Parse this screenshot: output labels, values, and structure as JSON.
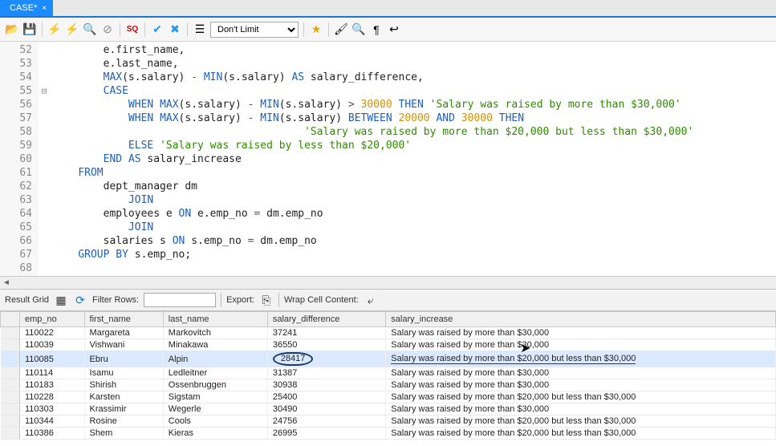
{
  "tab": {
    "title": "CASE*",
    "close": "×"
  },
  "toolbar": {
    "limit_value": "Don't Limit"
  },
  "editor": {
    "lines": [
      {
        "n": "52",
        "html": "        e.first_name,"
      },
      {
        "n": "53",
        "html": "        e.last_name,"
      },
      {
        "n": "54",
        "html": "        <span class='fn'>MAX</span>(s.salary) <span class='op'>-</span> <span class='fn'>MIN</span>(s.salary) <span class='kw'>AS</span> salary_difference,"
      },
      {
        "n": "55",
        "html": "        <span class='kw'>CASE</span>",
        "fold": "⊟"
      },
      {
        "n": "56",
        "html": "            <span class='kw'>WHEN</span> <span class='fn'>MAX</span>(s.salary) <span class='op'>-</span> <span class='fn'>MIN</span>(s.salary) <span class='op'>&gt;</span> <span class='num'>30000</span> <span class='kw'>THEN</span> <span class='str'>'Salary was raised by more than $30,000'</span>"
      },
      {
        "n": "57",
        "html": "            <span class='kw'>WHEN</span> <span class='fn'>MAX</span>(s.salary) <span class='op'>-</span> <span class='fn'>MIN</span>(s.salary) <span class='kw'>BETWEEN</span> <span class='num'>20000</span> <span class='kw'>AND</span> <span class='num'>30000</span> <span class='kw'>THEN</span>"
      },
      {
        "n": "58",
        "html": "                                        <span class='str'>'Salary was raised by more than $20,000 but less than $30,000'</span>"
      },
      {
        "n": "59",
        "html": "            <span class='kw'>ELSE</span> <span class='str'>'Salary was raised by less than $20,000'</span>"
      },
      {
        "n": "60",
        "html": "        <span class='kw'>END</span> <span class='kw'>AS</span> salary_increase"
      },
      {
        "n": "61",
        "html": "    <span class='kw'>FROM</span>"
      },
      {
        "n": "62",
        "html": "        dept_manager dm"
      },
      {
        "n": "63",
        "html": "            <span class='kw'>JOIN</span>"
      },
      {
        "n": "64",
        "html": "        employees e <span class='kw'>ON</span> e.emp_no <span class='op'>=</span> dm.emp_no"
      },
      {
        "n": "65",
        "html": "            <span class='kw'>JOIN</span>"
      },
      {
        "n": "66",
        "html": "        salaries s <span class='kw'>ON</span> s.emp_no <span class='op'>=</span> dm.emp_no"
      },
      {
        "n": "67",
        "html": "    <span class='kw'>GROUP BY</span> s.emp_no;"
      },
      {
        "n": "68",
        "html": ""
      }
    ]
  },
  "results": {
    "grid_label": "Result Grid",
    "filter_label": "Filter Rows:",
    "filter_value": "",
    "export_label": "Export:",
    "wrap_label": "Wrap Cell Content:",
    "columns": [
      "emp_no",
      "first_name",
      "last_name",
      "salary_difference",
      "salary_increase"
    ],
    "rows": [
      [
        "110022",
        "Margareta",
        "Markovitch",
        "37241",
        "Salary was raised by more than $30,000"
      ],
      [
        "110039",
        "Vishwani",
        "Minakawa",
        "36550",
        "Salary was raised by more than $30,000"
      ],
      [
        "110085",
        "Ebru",
        "Alpin",
        "28417",
        "Salary was raised by more than $20,000 but less than $30,000"
      ],
      [
        "110114",
        "Isamu",
        "Ledleitner",
        "31387",
        "Salary was raised by more than $30,000"
      ],
      [
        "110183",
        "Shirish",
        "Ossenbruggen",
        "30938",
        "Salary was raised by more than $30,000"
      ],
      [
        "110228",
        "Karsten",
        "Sigstam",
        "25400",
        "Salary was raised by more than $20,000 but less than $30,000"
      ],
      [
        "110303",
        "Krassimir",
        "Wegerle",
        "30490",
        "Salary was raised by more than $30,000"
      ],
      [
        "110344",
        "Rosine",
        "Cools",
        "24756",
        "Salary was raised by more than $20,000 but less than $30,000"
      ],
      [
        "110386",
        "Shem",
        "Kieras",
        "26995",
        "Salary was raised by more than $20,000 but less than $30,000"
      ]
    ],
    "selected_row": 2
  }
}
